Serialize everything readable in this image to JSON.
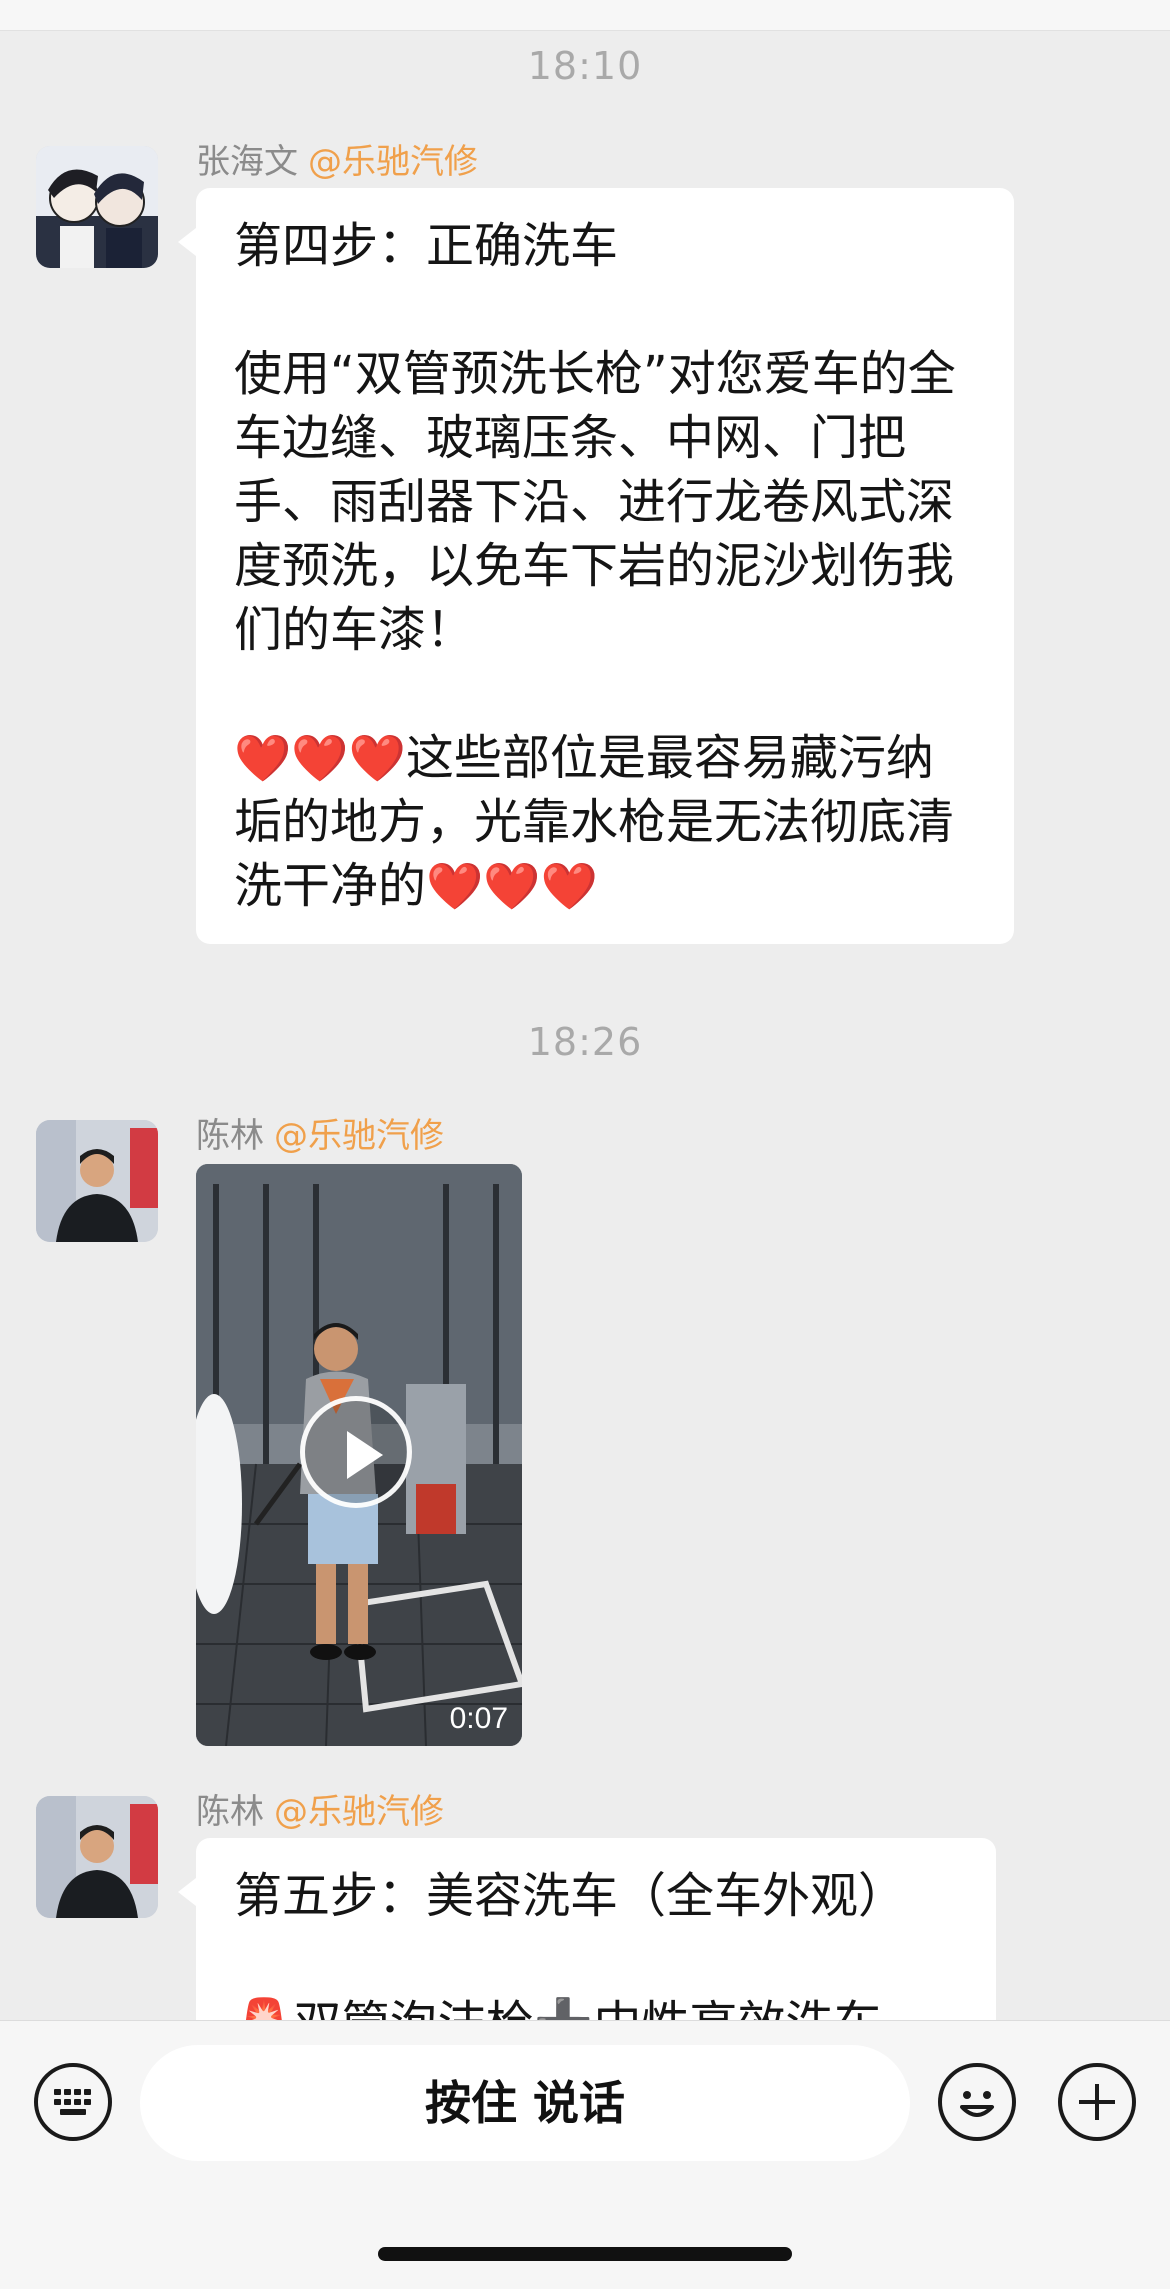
{
  "chat": {
    "messages": [
      {
        "time": "18:10",
        "sender": "张海文",
        "org": "@乐驰汽修",
        "title": "第四步：正确洗车",
        "para1": "使用“双管预洗长枪”对您爱车的全车边缝、玻璃压条、中网、门把手、雨刮器下沿、进行龙卷风式深度预洗，以免车下岩的泥沙划伤我们的车漆！",
        "hearts_lead": "❤️❤️❤️",
        "para2": "这些部位是最容易藏污纳垢的地方，光靠水枪是无法彻底清洗干净的",
        "hearts_tail": "❤️❤️❤️"
      },
      {
        "time": "18:26",
        "sender": "陈林",
        "org": "@乐驰汽修",
        "video_duration": "0:07"
      },
      {
        "sender": "陈林",
        "org": "@乐驰汽修",
        "title": "第五步：美容洗车（全车外观）",
        "partial": "🚨双管泡沫枪➕中性高效洗车"
      }
    ]
  },
  "input_bar": {
    "talk_label": "按住 说话",
    "keyboard_icon": "keyboard-icon",
    "emoji_icon": "emoji-icon",
    "plus_icon": "plus-icon"
  }
}
